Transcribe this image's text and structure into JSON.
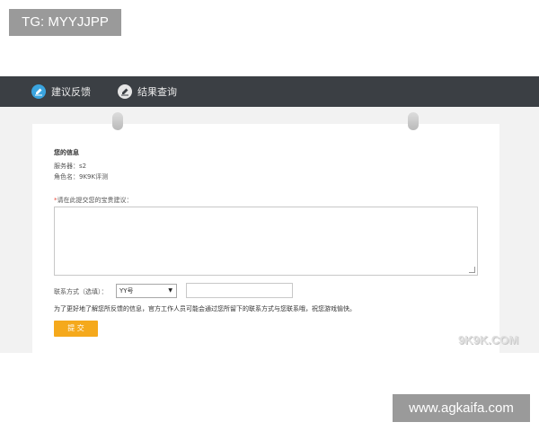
{
  "overlay": {
    "tg_label": "TG: MYYJJPP",
    "site_label": "www.agkaifa.com"
  },
  "nav": {
    "items": [
      {
        "label": "建议反馈",
        "icon": "edit-icon"
      },
      {
        "label": "结果查询",
        "icon": "edit-icon"
      }
    ]
  },
  "info": {
    "title": "您的信息",
    "server_line": "服务器：s2",
    "role_line": "角色名：9K9K评测"
  },
  "form": {
    "prompt_star": "*",
    "prompt_text": "请在此提交您的宝贵建议：",
    "contact_label": "联系方式（选填）：",
    "contact_type_selected": "YY号",
    "contact_value": "",
    "notice": "为了更好地了解您所反馈的信息，官方工作人员可能会通过您所留下的联系方式与您联系哦，祝您游戏愉快。",
    "submit_label": "提 交"
  },
  "watermark": "9K9K.COM",
  "colors": {
    "topbar": "#3b3f44",
    "accent_blue": "#3aa4df",
    "submit": "#f5a91c"
  }
}
